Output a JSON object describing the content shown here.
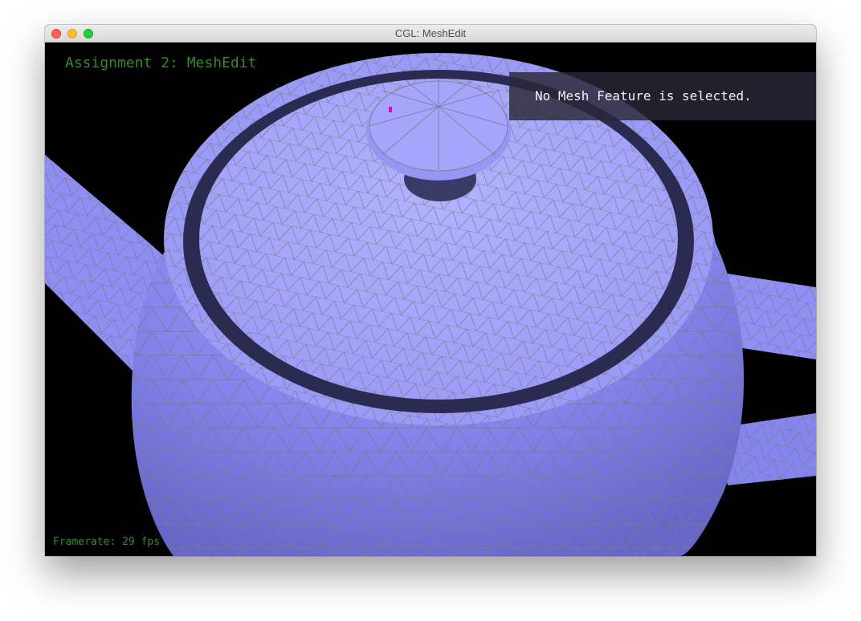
{
  "window": {
    "title": "CGL: MeshEdit",
    "controls": {
      "close_icon": "close-dot",
      "minimize_icon": "minimize-dot",
      "zoom_icon": "zoom-dot"
    }
  },
  "hud": {
    "title": "Assignment 2: MeshEdit",
    "selection_info": "No Mesh Feature is selected.",
    "framerate": "Framerate: 29 fps"
  },
  "scene": {
    "model": "teapot",
    "background": "#000000",
    "mesh_fill": "#8c8cf5",
    "mesh_fill_light": "#a9a9fb",
    "mesh_fill_dark": "#6e6ed2",
    "edge_color": "#7a7a8c",
    "cavity_color": "#2b2b52",
    "selection_marker_color": "#e000c8"
  }
}
